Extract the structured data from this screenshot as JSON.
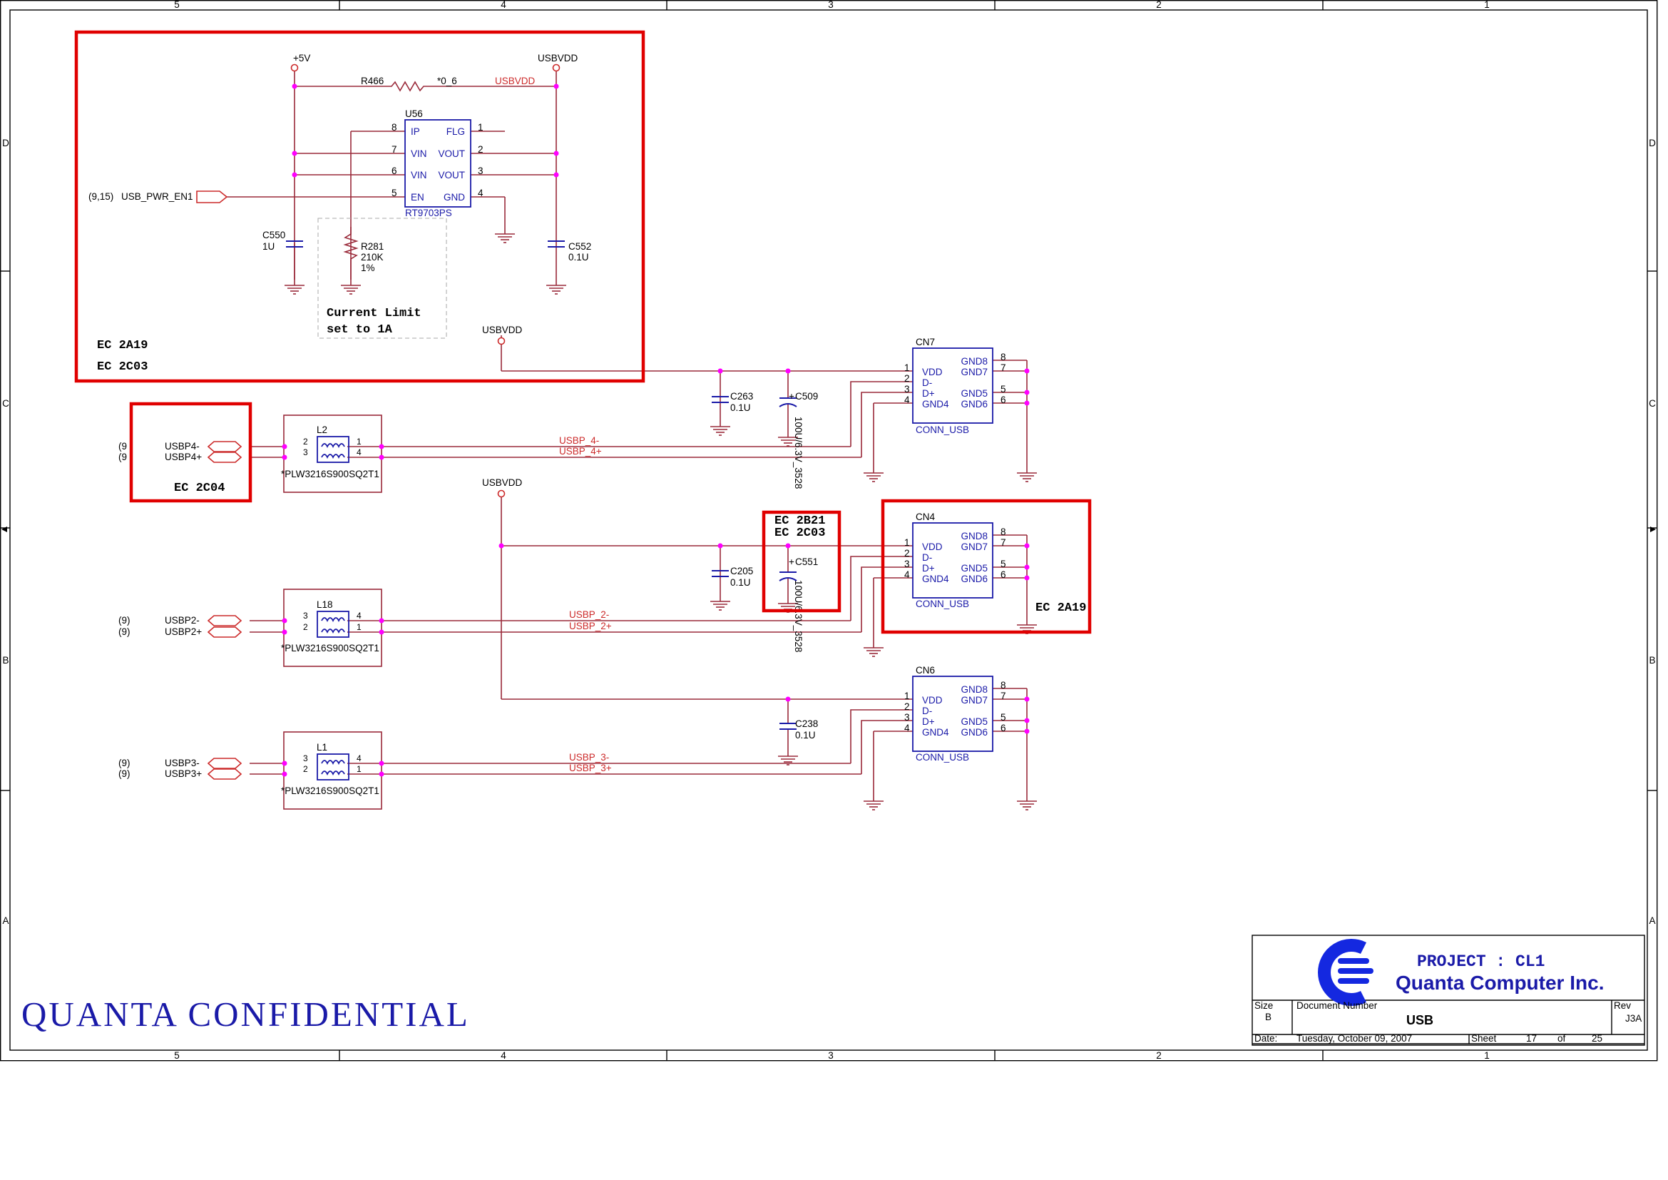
{
  "colors": {
    "wire": "#9a2a3a",
    "net_label": "#cc2a2a",
    "junction": "#ff00ff",
    "part": "#1a1aa8",
    "highlight": "#e00000",
    "frame": "#000000",
    "logo": "#1428e0",
    "confidential": "#1a1aa8"
  },
  "border": {
    "columns": [
      "5",
      "4",
      "3",
      "2",
      "1"
    ],
    "rows": [
      "D",
      "C",
      "B",
      "A"
    ]
  },
  "power_switch": {
    "rail_5v": "+5V",
    "rail_usbvdd": "USBVDD",
    "r466_ref": "R466",
    "r466_value": "*0_6",
    "net_usbvdd": "USBVDD",
    "u56_ref": "U56",
    "u56_part": "RT9703PS",
    "pins_left": [
      {
        "num": "8",
        "name": "IP"
      },
      {
        "num": "7",
        "name": "VIN"
      },
      {
        "num": "6",
        "name": "VIN"
      },
      {
        "num": "5",
        "name": "EN"
      }
    ],
    "pins_right": [
      {
        "num": "1",
        "name": "FLG"
      },
      {
        "num": "2",
        "name": "VOUT"
      },
      {
        "num": "3",
        "name": "VOUT"
      },
      {
        "num": "4",
        "name": "GND"
      }
    ],
    "enable_net_ref": "(9,15)",
    "enable_net": "USB_PWR_EN1",
    "c550_ref": "C550",
    "c550_value": "1U",
    "r281_ref": "R281",
    "r281_value": "210K",
    "r281_tol": "1%",
    "c552_ref": "C552",
    "c552_value": "0.1U",
    "note_line1": "Current Limit",
    "note_line2": "set to 1A",
    "ec_line1": "EC 2A19",
    "ec_line2": "EC 2C03"
  },
  "rail_label_cn7": "USBVDD",
  "rail_label_cn4": "USBVDD",
  "caps": {
    "c263_ref": "C263",
    "c263_value": "0.1U",
    "c509_ref": "C509",
    "c509_value": "100U/6.3V_3528",
    "c205_ref": "C205",
    "c205_value": "0.1U",
    "c551_ref": "C551",
    "c551_value": "100U/6.3V_3528",
    "c238_ref": "C238",
    "c238_value": "0.1U"
  },
  "ports": [
    {
      "connector_ref": "CN7",
      "connector_part": "CONN_USB",
      "choke_ref": "L2",
      "choke_part": "*PLW3216S900SQ2T1",
      "minus_ref": "(9",
      "plus_ref": "(9",
      "minus_net": "USBP4-",
      "plus_net": "USBP4+",
      "minus_wire": "USBP_4-",
      "plus_wire": "USBP_4+",
      "choke_pins": [
        "2",
        "3",
        "1",
        "4"
      ]
    },
    {
      "connector_ref": "CN4",
      "connector_part": "CONN_USB",
      "choke_ref": "L18",
      "choke_part": "*PLW3216S900SQ2T1",
      "minus_ref": "(9)",
      "plus_ref": "(9)",
      "minus_net": "USBP2-",
      "plus_net": "USBP2+",
      "minus_wire": "USBP_2-",
      "plus_wire": "USBP_2+",
      "choke_pins": [
        "3",
        "2",
        "4",
        "1"
      ]
    },
    {
      "connector_ref": "CN6",
      "connector_part": "CONN_USB",
      "choke_ref": "L1",
      "choke_part": "*PLW3216S900SQ2T1",
      "minus_ref": "(9)",
      "plus_ref": "(9)",
      "minus_net": "USBP3-",
      "plus_net": "USBP3+",
      "minus_wire": "USBP_3-",
      "plus_wire": "USBP_3+",
      "choke_pins": [
        "3",
        "2",
        "4",
        "1"
      ]
    }
  ],
  "connector_pins": {
    "left_num": [
      "1",
      "2",
      "3",
      "4"
    ],
    "left_name": [
      "VDD",
      "D-",
      "D+",
      "GND4"
    ],
    "right_name": [
      "GND8",
      "GND7",
      "GND5",
      "GND6"
    ],
    "right_num": [
      "8",
      "7",
      "5",
      "6"
    ]
  },
  "ec_boxes": {
    "usbp4": "EC 2C04",
    "c551_line1": "EC 2B21",
    "c551_line2": "EC 2C03",
    "cn4": "EC 2A19"
  },
  "confidential": "QUANTA CONFIDENTIAL",
  "title_block": {
    "project": "PROJECT : CL1",
    "company": "Quanta Computer Inc.",
    "size_label": "Size",
    "size_value": "B",
    "doc_label": "Document Number",
    "doc_value": "USB",
    "rev_label": "Rev",
    "rev_value": "J3A",
    "date_label": "Date:",
    "date_value": "Tuesday, October 09, 2007",
    "sheet_label": "Sheet",
    "sheet_value": "17",
    "of_label": "of",
    "of_value": "25"
  }
}
